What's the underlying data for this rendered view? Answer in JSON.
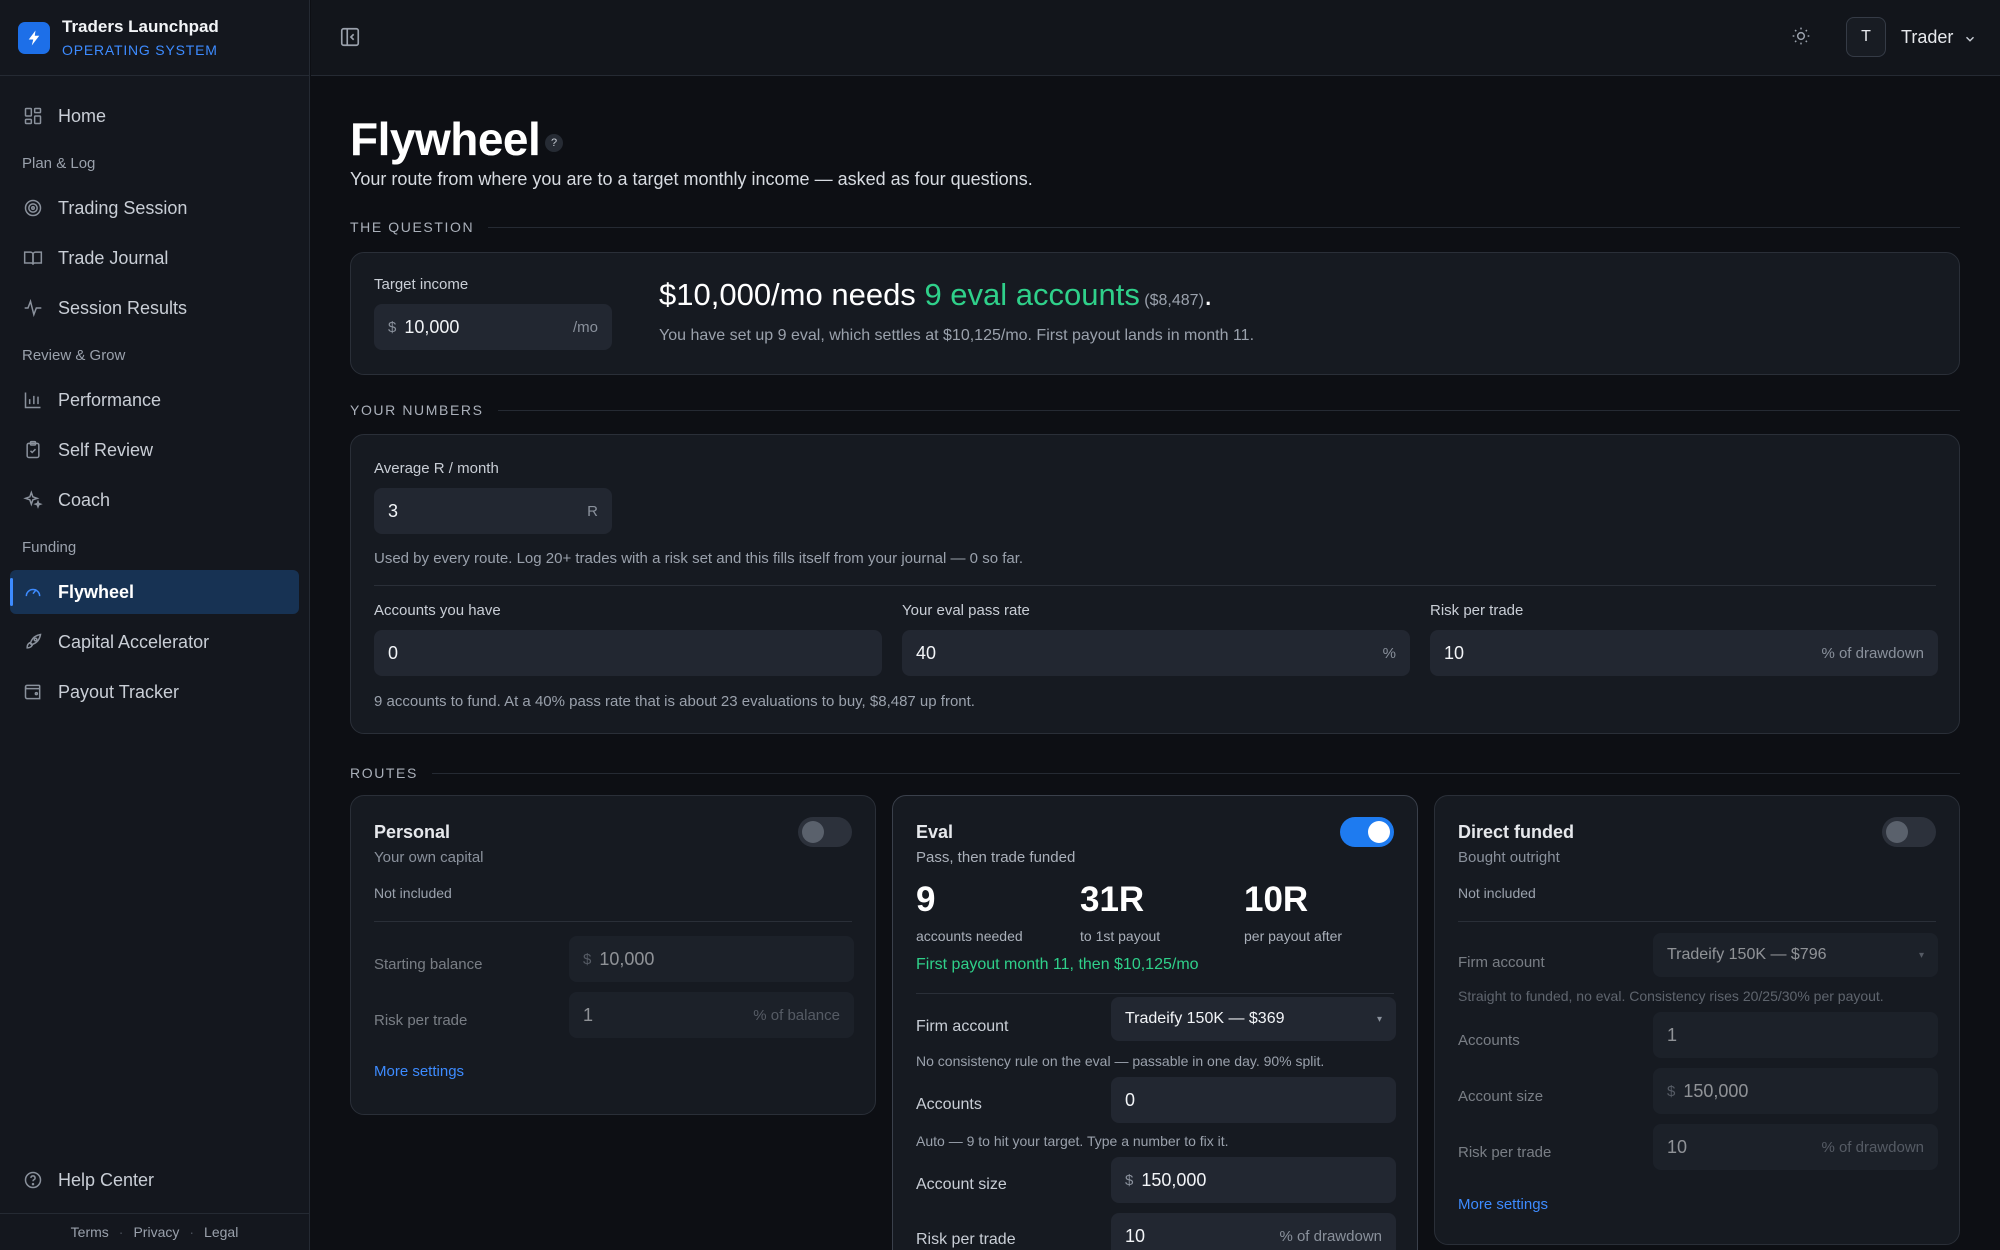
{
  "brand": {
    "name": "Traders Launchpad",
    "subtitle": "OPERATING SYSTEM"
  },
  "sidebar": {
    "home": "Home",
    "sections": [
      {
        "title": "Plan & Log",
        "items": [
          "Trading Session",
          "Trade Journal",
          "Session Results"
        ]
      },
      {
        "title": "Review & Grow",
        "items": [
          "Performance",
          "Self Review",
          "Coach"
        ]
      },
      {
        "title": "Funding",
        "items": [
          "Flywheel",
          "Capital Accelerator",
          "Payout Tracker"
        ]
      }
    ],
    "active": "Flywheel",
    "help": "Help Center",
    "footer": {
      "terms": "Terms",
      "privacy": "Privacy",
      "legal": "Legal",
      "separator": "·"
    }
  },
  "topbar": {
    "avatar_initial": "T",
    "user_name": "Trader"
  },
  "page": {
    "title": "Flywheel",
    "help_glyph": "?",
    "subtitle": "Your route from where you are to a target monthly income — asked as four questions."
  },
  "question": {
    "section_label": "THE QUESTION",
    "target_label": "Target income",
    "target_prefix": "$",
    "target_value": "10,000",
    "target_suffix": "/mo",
    "headline_part1": "$10,000/mo needs ",
    "headline_green": "9 eval accounts",
    "headline_small": " ($8,487)",
    "headline_end": ".",
    "detail": "You have set up 9 eval, which settles at $10,125/mo. First payout lands in month 11."
  },
  "numbers": {
    "section_label": "YOUR NUMBERS",
    "avg_r_label": "Average R / month",
    "avg_r_value": "3",
    "avg_r_suffix": "R",
    "avg_r_note": "Used by every route. Log 20+ trades with a risk set and this fills itself from your journal — 0 so far.",
    "accounts_label": "Accounts you have",
    "accounts_value": "0",
    "pass_rate_label": "Your eval pass rate",
    "pass_rate_value": "40",
    "pass_rate_suffix": "%",
    "risk_label": "Risk per trade",
    "risk_value": "10",
    "risk_suffix": "% of drawdown",
    "summary": "9 accounts to fund. At a 40% pass rate that is about 23 evaluations to buy, $8,487 up front."
  },
  "routes": {
    "section_label": "ROUTES",
    "personal": {
      "title": "Personal",
      "subtitle": "Your own capital",
      "enabled": false,
      "status": "Not included",
      "balance_label": "Starting balance",
      "balance_prefix": "$",
      "balance_value": "10,000",
      "risk_label": "Risk per trade",
      "risk_value": "1",
      "risk_suffix": "% of balance",
      "more": "More settings"
    },
    "eval": {
      "title": "Eval",
      "subtitle": "Pass, then trade funded",
      "enabled": true,
      "stats": [
        {
          "value": "9",
          "label": "accounts needed"
        },
        {
          "value": "31R",
          "label": "to 1st payout"
        },
        {
          "value": "10R",
          "label": "per payout after"
        }
      ],
      "payout_note": "First payout month 11, then $10,125/mo",
      "firm_label": "Firm account",
      "firm_value": "Tradeify 150K — $369",
      "caret": "▾",
      "firm_note": "No consistency rule on the eval — passable in one day. 90% split.",
      "accounts_label": "Accounts",
      "accounts_value": "0",
      "accounts_note": "Auto — 9 to hit your target. Type a number to fix it.",
      "size_label": "Account size",
      "size_prefix": "$",
      "size_value": "150,000",
      "risk_label": "Risk per trade",
      "risk_value": "10",
      "risk_suffix": "% of drawdown"
    },
    "direct": {
      "title": "Direct funded",
      "subtitle": "Bought outright",
      "enabled": false,
      "status": "Not included",
      "firm_label": "Firm account",
      "firm_value": "Tradeify 150K — $796",
      "caret": "▾",
      "firm_note": "Straight to funded, no eval. Consistency rises 20/25/30% per payout.",
      "accounts_label": "Accounts",
      "accounts_value": "1",
      "size_label": "Account size",
      "size_prefix": "$",
      "size_value": "150,000",
      "risk_label": "Risk per trade",
      "risk_value": "10",
      "risk_suffix": "% of drawdown",
      "more": "More settings"
    }
  },
  "icons": {
    "brand": "bolt-icon",
    "home": "grid-icon",
    "trading_session": "target-icon",
    "trade_journal": "book-icon",
    "session_results": "pulse-icon",
    "performance": "bar-chart-icon",
    "self_review": "clipboard-icon",
    "coach": "sparkles-icon",
    "flywheel": "gauge-icon",
    "capital_accelerator": "rocket-icon",
    "payout_tracker": "wallet-icon",
    "help": "help-circle-icon",
    "collapse": "sidebar-collapse-icon",
    "theme": "sun-icon",
    "user_menu": "chevron-down-icon"
  },
  "colors": {
    "accent": "#3d8bff",
    "positive": "#2fd08a",
    "background": "#0d0f14",
    "card": "#161a21"
  }
}
